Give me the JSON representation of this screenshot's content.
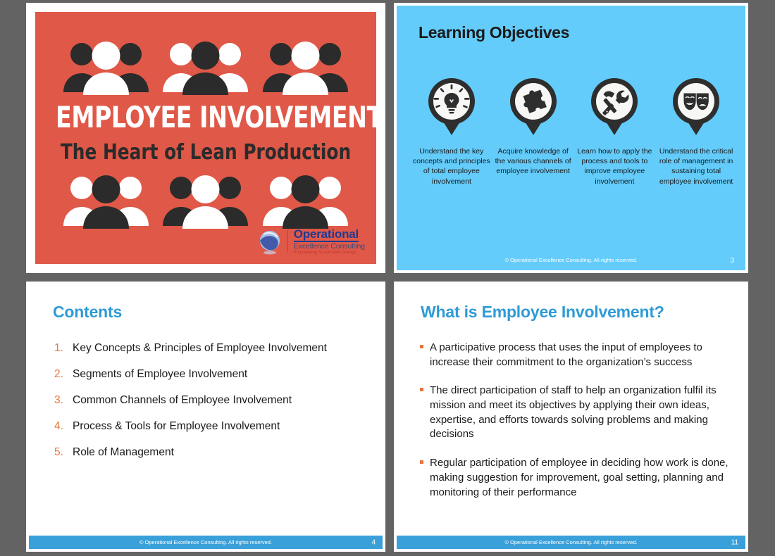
{
  "deck": {
    "background_color": "#636363",
    "brand": {
      "accent_blue": "#2e9bd6",
      "footer_blue": "#3aa0da",
      "light_blue": "#63ccfb",
      "red": "#e05848",
      "orange": "#e8743b"
    }
  },
  "title_slide": {
    "main_title": "EMPLOYEE INVOLVEMENT",
    "sub_title": "The Heart of Lean Production",
    "logo": {
      "line1": "Operational",
      "line2": "Excellence Consulting",
      "line3": "Empowering Sustainable Change",
      "icon": "globe-icon"
    },
    "people_groups": [
      {
        "name": "people-group-1",
        "pattern": "dark-white-dark"
      },
      {
        "name": "people-group-2",
        "pattern": "white-dark-white"
      },
      {
        "name": "people-group-3",
        "pattern": "dark-white-dark"
      },
      {
        "name": "people-group-4",
        "pattern": "white-dark-white"
      },
      {
        "name": "people-group-5",
        "pattern": "dark-white-dark"
      },
      {
        "name": "people-group-6",
        "pattern": "white-dark-white"
      }
    ]
  },
  "objectives_slide": {
    "title": "Learning Objectives",
    "items": [
      {
        "icon": "lightbulb-icon",
        "caption": "Understand the key concepts and principles of total employee involvement"
      },
      {
        "icon": "puzzle-piece-icon",
        "caption": "Acquire knowledge of the various channels of employee involvement"
      },
      {
        "icon": "hammer-wrench-icon",
        "caption": "Learn how to apply the process and tools to improve employee involvement"
      },
      {
        "icon": "theater-masks-icon",
        "caption": "Understand the critical role of management in sustaining total employee involvement"
      }
    ],
    "footer": "© Operational Excellence Consulting.  All rights reserved.",
    "page_number": "3"
  },
  "contents_slide": {
    "heading": "Contents",
    "items": [
      {
        "num": "1.",
        "label": "Key Concepts & Principles of Employee Involvement"
      },
      {
        "num": "2.",
        "label": "Segments of Employee Involvement"
      },
      {
        "num": "3.",
        "label": "Common Channels of Employee Involvement"
      },
      {
        "num": "4.",
        "label": "Process & Tools for Employee Involvement"
      },
      {
        "num": "5.",
        "label": "Role of Management"
      }
    ],
    "footer": "© Operational Excellence Consulting.  All rights reserved.",
    "page_number": "4"
  },
  "whatis_slide": {
    "heading": "What is Employee Involvement?",
    "bullets": [
      "A participative process that uses the input of employees to increase their commitment to the organization’s success",
      "The direct participation of staff to help an organization fulfil its mission and meet its objectives by applying their own ideas, expertise, and efforts towards solving problems and making decisions",
      "Regular participation of employee in deciding how work is done, making suggestion for improvement, goal setting, planning and monitoring of their performance"
    ],
    "footer": "© Operational Excellence Consulting.  All rights reserved.",
    "page_number": "11"
  }
}
